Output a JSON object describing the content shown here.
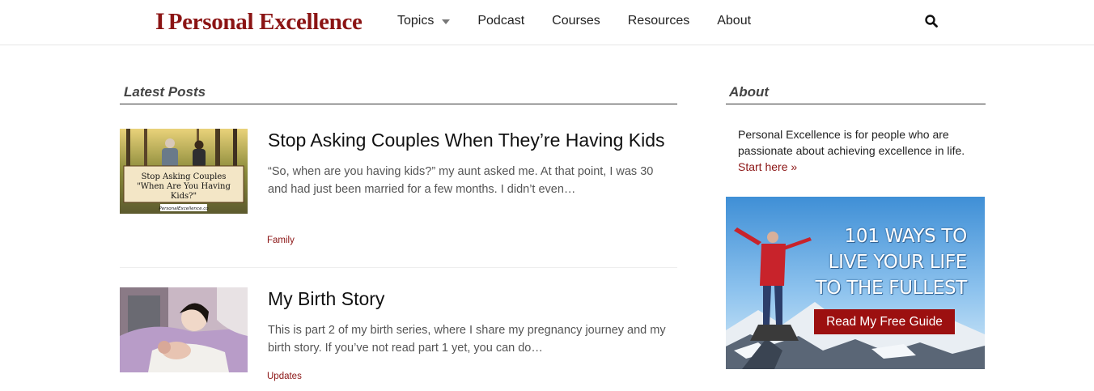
{
  "header": {
    "logo_mark": "I",
    "logo_text": "Personal Excellence",
    "nav": [
      {
        "label": "Topics"
      },
      {
        "label": "Podcast"
      },
      {
        "label": "Courses"
      },
      {
        "label": "Resources"
      },
      {
        "label": "About"
      }
    ]
  },
  "main": {
    "section_title": "Latest Posts",
    "posts": [
      {
        "title": "Stop Asking Couples When They’re Having Kids",
        "excerpt": "“So, when are you having kids?” my aunt asked me. At that point, I was 30 and had just been married for a few months. I didn’t even…",
        "tag": "Family",
        "thumb_caption_1": "Stop Asking Couples",
        "thumb_caption_2": "\"When Are You Having",
        "thumb_caption_3": "Kids?\"",
        "thumb_credit": "PersonalExcellence.co"
      },
      {
        "title": "My Birth Story",
        "excerpt": "This is part 2 of my birth series, where I share my pregnancy journey and my birth story. If you’ve not read part 1 yet, you can do…",
        "tag": "Updates"
      }
    ]
  },
  "sidebar": {
    "section_title": "About",
    "about_text": "Personal Excellence is for people who are passionate about achieving excellence in life.",
    "start_link": "Start here »",
    "promo": {
      "line1": "101 WAYS TO",
      "line2": "LIVE YOUR LIFE",
      "line3": "TO THE FULLEST",
      "button": "Read My Free Guide"
    }
  },
  "colors": {
    "brand": "#8b1414",
    "button": "#9c1010"
  }
}
